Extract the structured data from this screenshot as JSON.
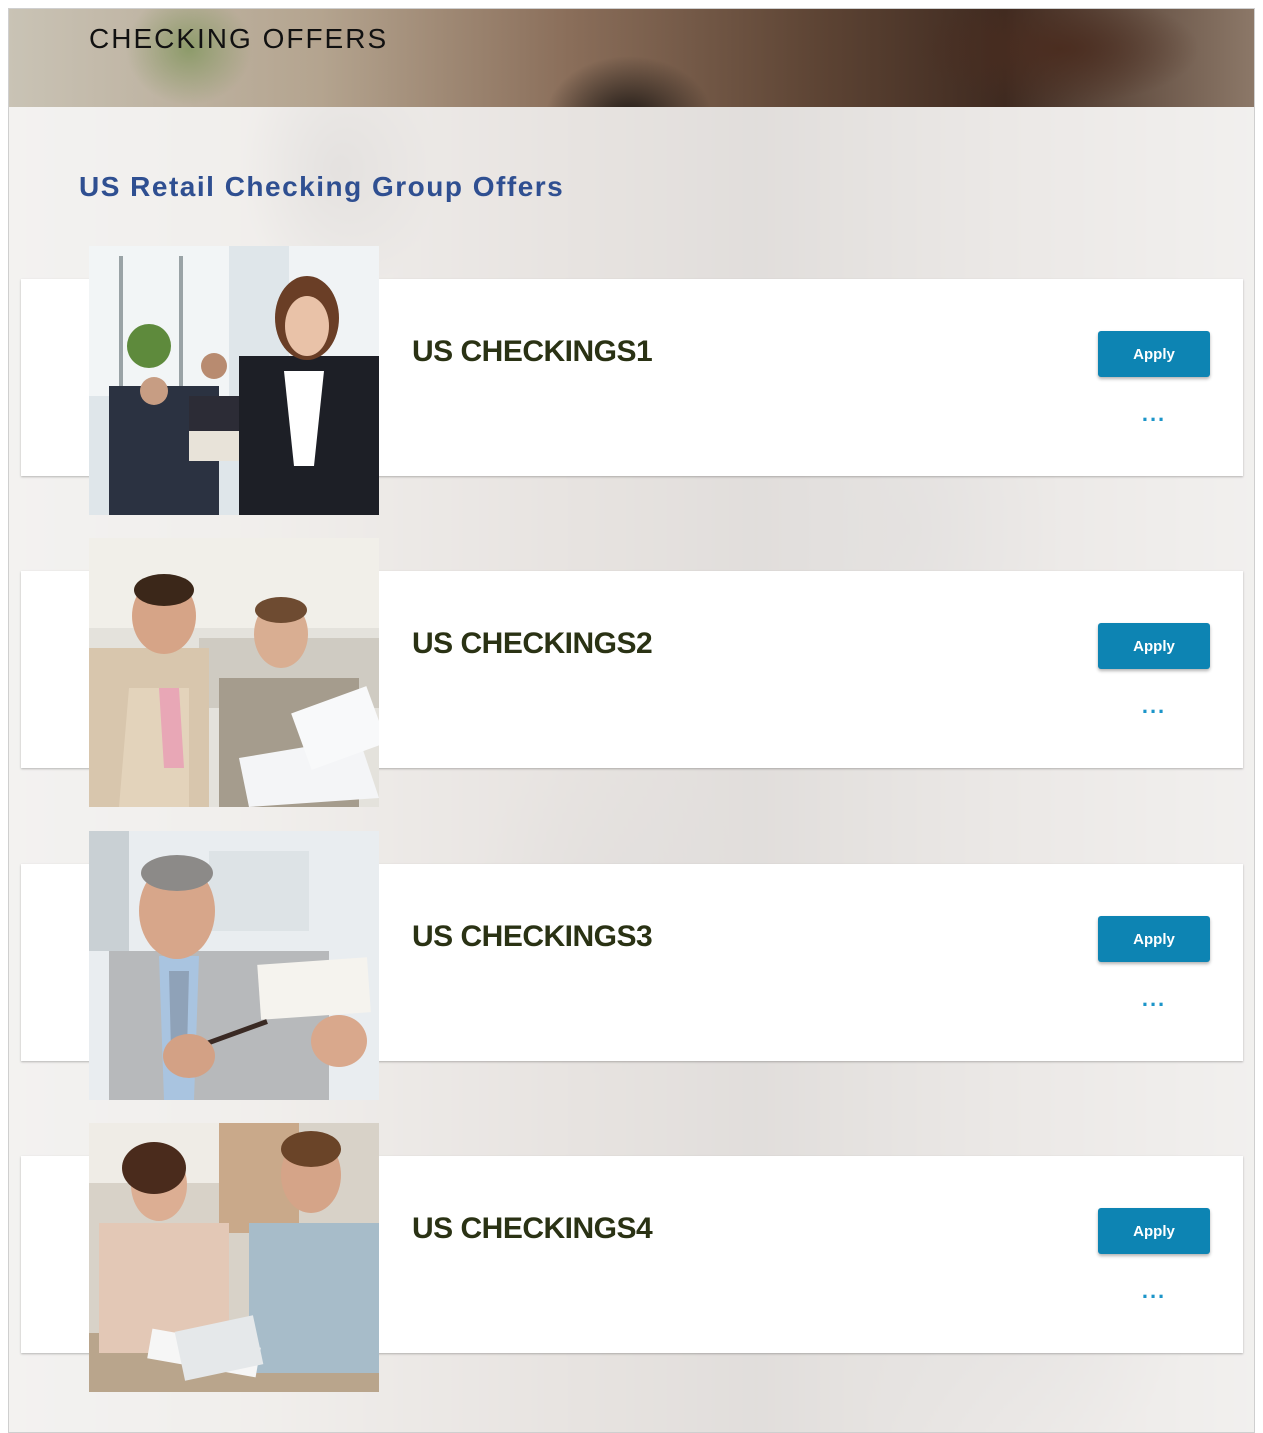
{
  "header": {
    "title": "CHECKING OFFERS"
  },
  "group": {
    "heading": "US Retail Checking Group Offers"
  },
  "offers": [
    {
      "name": "US CHECKINGS1",
      "apply_label": "Apply",
      "more_label": "..."
    },
    {
      "name": "US CHECKINGS2",
      "apply_label": "Apply",
      "more_label": "..."
    },
    {
      "name": "US CHECKINGS3",
      "apply_label": "Apply",
      "more_label": "..."
    },
    {
      "name": "US CHECKINGS4",
      "apply_label": "Apply",
      "more_label": "..."
    }
  ],
  "colors": {
    "heading": "#2f4f91",
    "offer_name": "#2a3214",
    "apply_button": "#0d84b3",
    "more_icon": "#1c95c9"
  }
}
